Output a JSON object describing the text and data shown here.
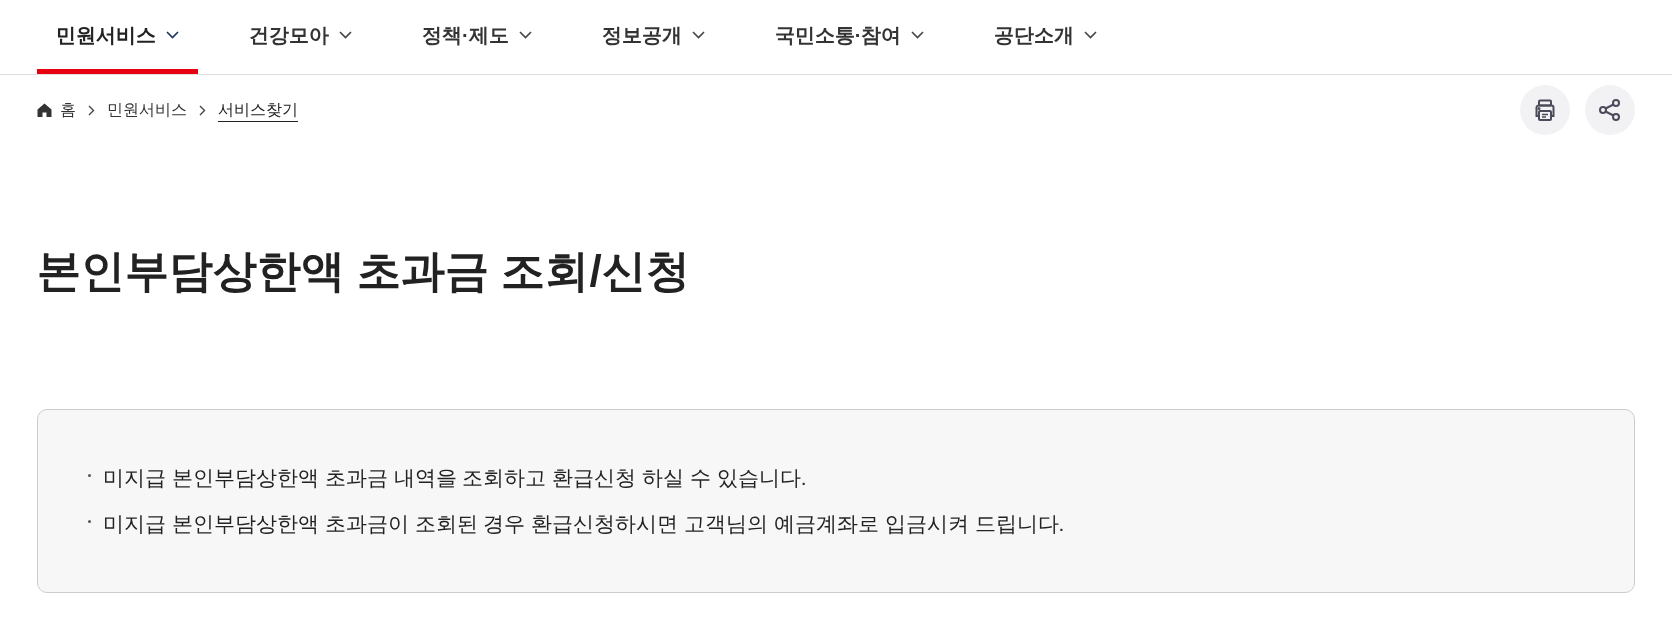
{
  "nav": {
    "items": [
      {
        "label": "민원서비스",
        "selected": true
      },
      {
        "label": "건강모아",
        "selected": false
      },
      {
        "label": "정책·제도",
        "selected": false
      },
      {
        "label": "정보공개",
        "selected": false
      },
      {
        "label": "국민소통·참여",
        "selected": false
      },
      {
        "label": "공단소개",
        "selected": false
      }
    ]
  },
  "breadcrumb": [
    {
      "kind": "home",
      "label": "홈",
      "current": false
    },
    {
      "kind": "link",
      "label": "민원서비스",
      "current": false
    },
    {
      "kind": "link",
      "label": "서비스찾기",
      "current": true
    }
  ],
  "actions": [
    {
      "kind": "print"
    },
    {
      "kind": "share"
    }
  ],
  "page_title": "본인부담상한액 초과금 조회/신청",
  "notice": {
    "items": [
      "미지급 본인부담상한액 초과금 내역을 조회하고 환급신청 하실 수 있습니다.",
      "미지급 본인부담상한액 초과금이 조회된 경우 환급신청하시면 고객님의 예금계좌로 입금시켜 드립니다."
    ]
  }
}
